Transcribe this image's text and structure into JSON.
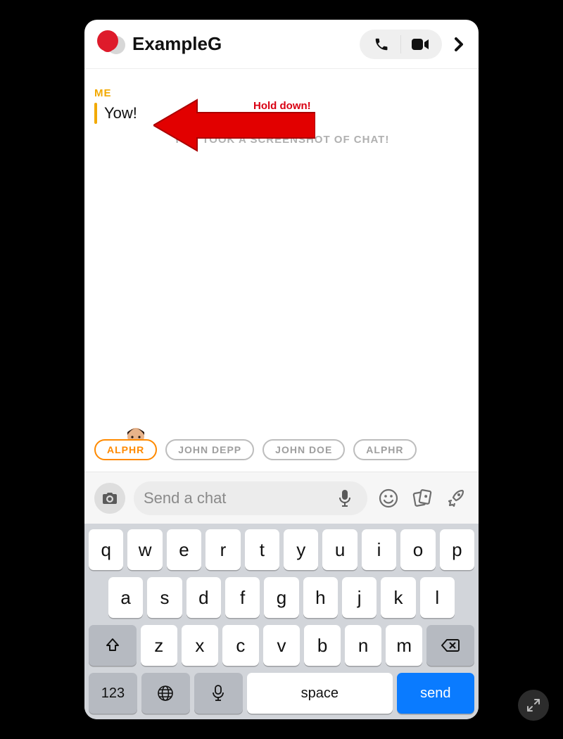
{
  "header": {
    "title": "ExampleG"
  },
  "chat": {
    "sender_label": "ME",
    "message": "Yow!",
    "system_message": "YOU TOOK A SCREENSHOT OF CHAT!",
    "annotation_label": "Hold down!"
  },
  "mentions": {
    "items": [
      {
        "label": "ALPHR",
        "active": true
      },
      {
        "label": "JOHN DEPP",
        "active": false
      },
      {
        "label": "JOHN DOE",
        "active": false
      },
      {
        "label": "ALPHR",
        "active": false
      }
    ]
  },
  "input": {
    "placeholder": "Send a chat"
  },
  "keyboard": {
    "row1": [
      "q",
      "w",
      "e",
      "r",
      "t",
      "y",
      "u",
      "i",
      "o",
      "p"
    ],
    "row2": [
      "a",
      "s",
      "d",
      "f",
      "g",
      "h",
      "j",
      "k",
      "l"
    ],
    "row3": [
      "z",
      "x",
      "c",
      "v",
      "b",
      "n",
      "m"
    ],
    "numkey": "123",
    "space": "space",
    "send": "send"
  }
}
